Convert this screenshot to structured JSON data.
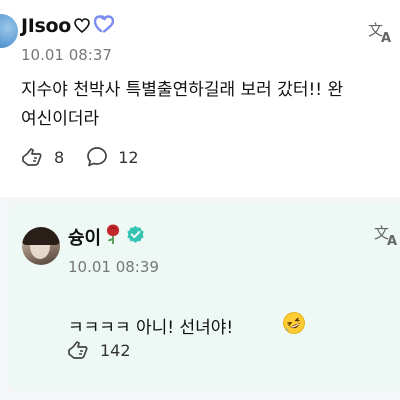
{
  "post": {
    "author": "JIsoo",
    "time": "10.01 08:37",
    "content_line1": "지수야 천박사 특별출연하길래 보러 갔터!! 완",
    "content_line2": "여신이더라",
    "likes": "8",
    "comments": "12"
  },
  "reply": {
    "author": "슝이",
    "time": "10.01 08:39",
    "content": "ㅋㅋㅋㅋ 아니! 선녀야!",
    "likes": "142"
  },
  "icons": {
    "heart": "outline-heart-icon",
    "badge": "double-heart-badge-icon",
    "translate": "translate-icon",
    "like": "like-hand-icon",
    "comment": "comment-bubble-icon",
    "rose": "rose-icon",
    "verified": "verified-check-icon",
    "laugh": "rolling-laughing-emoji"
  },
  "colors": {
    "badge_purple": "#7a8cf0",
    "verified_teal": "#35c3b3",
    "reply_background": "#eef9f6",
    "rose_red": "#c2282b"
  }
}
